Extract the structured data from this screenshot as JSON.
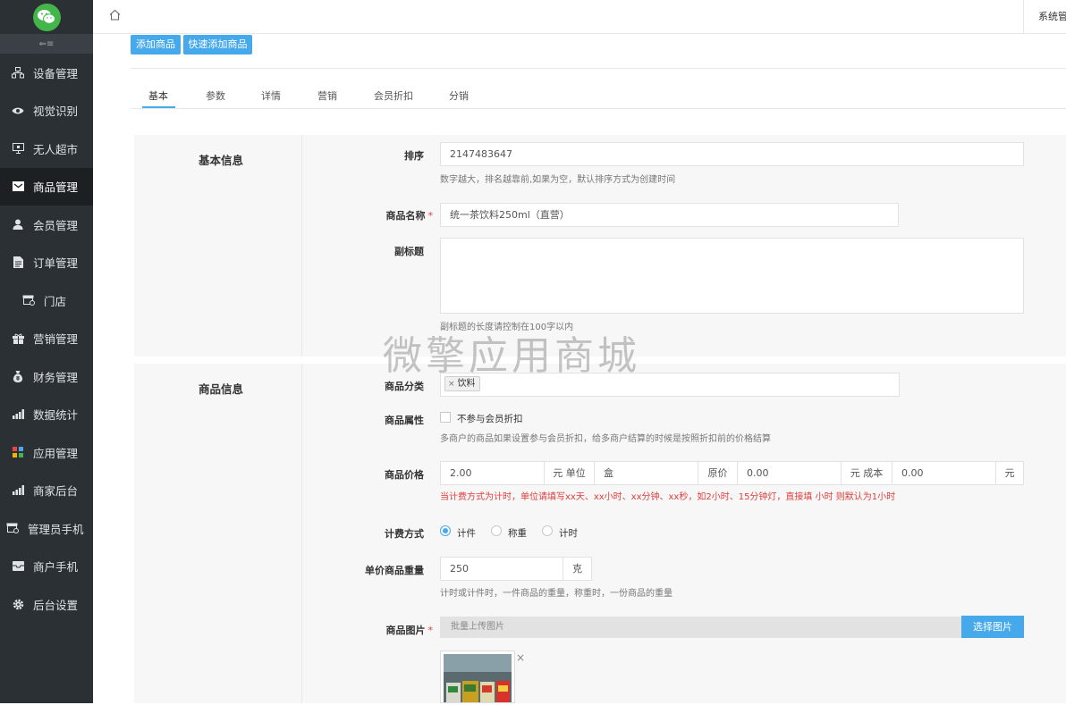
{
  "colors": {
    "sidebar_bg": "#2b3034",
    "sidebar_active": "#1c2023",
    "accent": "#46a9ec",
    "required": "#e03c3c",
    "wechat_green": "#44b549"
  },
  "sidebar": {
    "logo_icon": "wechat-logo-icon",
    "collapse_glyph": "⇐≡",
    "items": [
      {
        "label": "设备管理",
        "icon": "device-icon"
      },
      {
        "label": "视觉识别",
        "icon": "eye-icon"
      },
      {
        "label": "无人超市",
        "icon": "monitor-icon"
      },
      {
        "label": "商品管理",
        "icon": "goods-icon",
        "active": true
      },
      {
        "label": "会员管理",
        "icon": "user-icon"
      },
      {
        "label": "订单管理",
        "icon": "document-icon"
      },
      {
        "label": "门店",
        "icon": "store-icon"
      },
      {
        "label": "营销管理",
        "icon": "gift-icon"
      },
      {
        "label": "财务管理",
        "icon": "money-bag-icon"
      },
      {
        "label": "数据统计",
        "icon": "bar-chart-icon"
      },
      {
        "label": "应用管理",
        "icon": "apps-icon"
      },
      {
        "label": "商家后台",
        "icon": "bar-chart-icon"
      },
      {
        "label": "管理员手机",
        "icon": "store-icon"
      },
      {
        "label": "商户手机",
        "icon": "inbox-icon"
      },
      {
        "label": "后台设置",
        "icon": "gear-icon"
      }
    ]
  },
  "topbar": {
    "home_icon": "home-icon",
    "user_label": "系统管"
  },
  "actions": {
    "add": "添加商品",
    "quick_add": "快速添加商品"
  },
  "tabs": [
    "基本",
    "参数",
    "详情",
    "营销",
    "会员折扣",
    "分销"
  ],
  "sections": {
    "basic": "基本信息",
    "goods": "商品信息"
  },
  "form": {
    "sort": {
      "label": "排序",
      "value": "2147483647",
      "hint": "数字越大，排名越靠前,如果为空，默认排序方式为创建时间"
    },
    "name": {
      "label": "商品名称",
      "required": "*",
      "value": "统一茶饮料250ml（直营）"
    },
    "subtitle": {
      "label": "副标题",
      "value": "",
      "hint": "副标题的长度请控制在100字以内"
    },
    "category": {
      "label": "商品分类",
      "tag": "饮料",
      "tag_remove": "×"
    },
    "attribute": {
      "label": "商品属性",
      "checkbox": "不参与会员折扣",
      "hint": "多商户的商品如果设置参与会员折扣，给多商户结算的时候是按照折扣前的价格结算"
    },
    "price": {
      "label": "商品价格",
      "value": "2.00",
      "addon_unit": "元 单位",
      "unit": "盒",
      "addon_original": "原价",
      "original": "0.00",
      "addon_cost": "元 成本",
      "cost": "0.00",
      "addon_yuan": "元",
      "hint": "当计费方式为计时，单位请填写xx天、xx小时、xx分钟、xx秒，如2小时、15分钟灯，直接填 小时 则默认为1小时"
    },
    "billing": {
      "label": "计费方式",
      "options": [
        "计件",
        "称重",
        "计时"
      ],
      "selected": "计件"
    },
    "weight": {
      "label": "单价商品重量",
      "value": "250",
      "unit": "克",
      "hint": "计时或计件时，一件商品的重量，称重时，一份商品的重量"
    },
    "images": {
      "label": "商品图片",
      "required": "*",
      "placeholder": "批量上传图片",
      "button": "选择图片",
      "remove": "×"
    }
  },
  "watermark": "微擎应用商城"
}
